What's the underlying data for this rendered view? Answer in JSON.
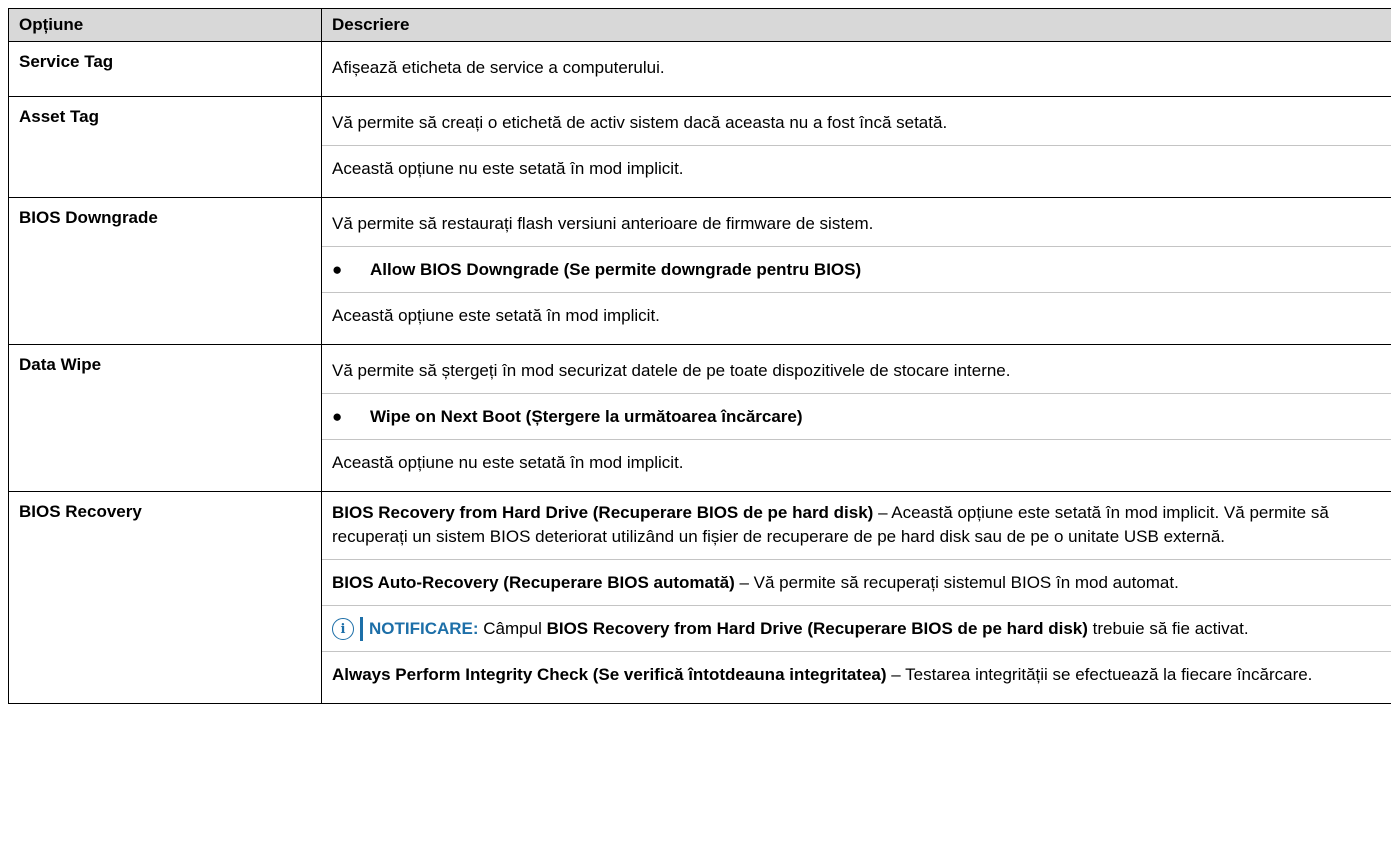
{
  "header": {
    "col_option": "Opțiune",
    "col_description": "Descriere"
  },
  "rows": {
    "service_tag": {
      "name": "Service Tag",
      "desc": "Afișează eticheta de service a computerului."
    },
    "asset_tag": {
      "name": "Asset Tag",
      "desc1": "Vă permite să creați o etichetă de activ sistem dacă aceasta nu a fost încă setată.",
      "desc2": "Această opțiune nu este setată în mod implicit."
    },
    "bios_downgrade": {
      "name": "BIOS Downgrade",
      "desc1": "Vă permite să restaurați flash versiuni anterioare de firmware de sistem.",
      "bullet": "Allow BIOS Downgrade (Se permite downgrade pentru BIOS)",
      "desc2": "Această opțiune este setată în mod implicit."
    },
    "data_wipe": {
      "name": "Data Wipe",
      "desc1": "Vă permite să ștergeți în mod securizat datele de pe toate dispozitivele de stocare interne.",
      "bullet": "Wipe on Next Boot (Ștergere la următoarea încărcare)",
      "desc2": "Această opțiune nu este setată în mod implicit."
    },
    "bios_recovery": {
      "name": "BIOS Recovery",
      "p1_bold": "BIOS Recovery from Hard Drive (Recuperare BIOS de pe hard disk)",
      "p1_text": " – Această opțiune este setată în mod implicit. Vă permite să recuperați un sistem BIOS deteriorat utilizând un fișier de recuperare de pe hard disk sau de pe o unitate USB externă.",
      "p2_bold": "BIOS Auto-Recovery (Recuperare BIOS automată)",
      "p2_text": " – Vă permite să recuperați sistemul BIOS în mod automat.",
      "note_label": "NOTIFICARE:",
      "note_pre": " Câmpul ",
      "note_bold": "BIOS Recovery from Hard Drive (Recuperare BIOS de pe hard disk)",
      "note_post": " trebuie să fie activat.",
      "p3_bold": "Always Perform Integrity Check (Se verifică întotdeauna integritatea)",
      "p3_text": " – Testarea integrității se efectuează la fiecare încărcare."
    }
  },
  "bullet_glyph": "●",
  "info_icon_glyph": "i",
  "colors": {
    "header_bg": "#d8d8d8",
    "note_accent": "#1d6fa8"
  }
}
